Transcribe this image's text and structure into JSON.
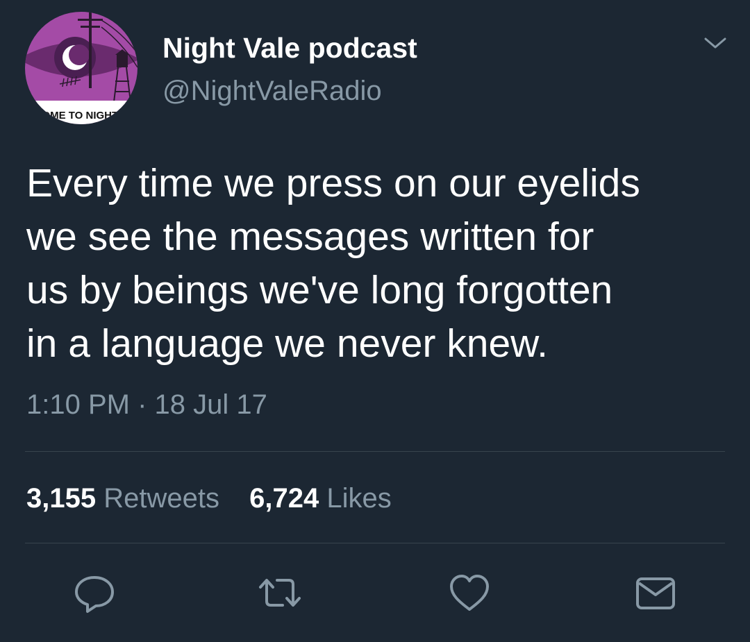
{
  "author": {
    "display_name": "Night Vale podcast",
    "handle": "@NightValeRadio",
    "avatar_text": "COME TO NIGHT V"
  },
  "tweet": {
    "text": "Every time we press on our eyelids\nwe see the messages written for\nus by beings we've long forgotten\nin a language we never knew.",
    "timestamp": "1:10 PM · 18 Jul 17"
  },
  "stats": {
    "retweets_count": "3,155",
    "retweets_label": "Retweets",
    "likes_count": "6,724",
    "likes_label": "Likes"
  },
  "actions": [
    {
      "name": "reply",
      "icon": "reply-icon"
    },
    {
      "name": "retweet",
      "icon": "retweet-icon"
    },
    {
      "name": "like",
      "icon": "heart-icon"
    },
    {
      "name": "direct-message",
      "icon": "envelope-icon"
    }
  ],
  "colors": {
    "background": "#1c2733",
    "primary_text": "#ffffff",
    "secondary_text": "#8899a6",
    "divider": "#38444d",
    "avatar_purple": "#a44ba6"
  }
}
